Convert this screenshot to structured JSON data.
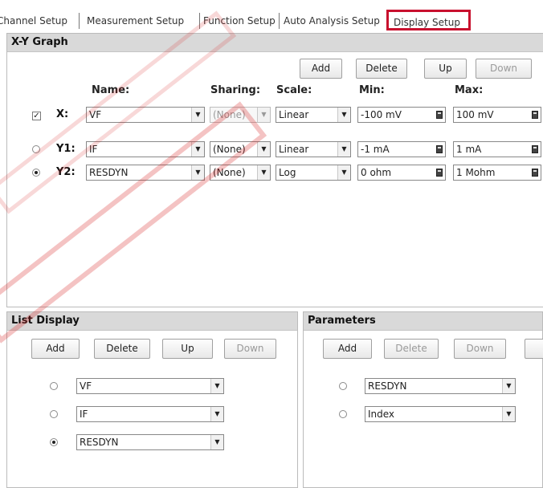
{
  "tabs": [
    {
      "label": "Channel Setup"
    },
    {
      "label": "Measurement Setup"
    },
    {
      "label": "Function Setup"
    },
    {
      "label": "Auto Analysis Setup"
    },
    {
      "label": "Display Setup"
    }
  ],
  "xy": {
    "title": "X-Y Graph",
    "buttons": {
      "add": "Add",
      "delete": "Delete",
      "up": "Up",
      "down": "Down"
    },
    "headers": {
      "name": "Name:",
      "sharing": "Sharing:",
      "scale": "Scale:",
      "min": "Min:",
      "max": "Max:"
    },
    "rows": [
      {
        "label": "X:",
        "name": "VF",
        "sharing": "(None)",
        "scale": "Linear",
        "min": "-100 mV",
        "max": "100 mV",
        "checked": true
      },
      {
        "label": "Y1:",
        "name": "IF",
        "sharing": "(None)",
        "scale": "Linear",
        "min": "-1 mA",
        "max": "1 mA",
        "selected": false
      },
      {
        "label": "Y2:",
        "name": "RESDYN",
        "sharing": "(None)",
        "scale": "Log",
        "min": "0 ohm",
        "max": "1 Mohm",
        "selected": true
      }
    ]
  },
  "list": {
    "title": "List Display",
    "buttons": {
      "add": "Add",
      "delete": "Delete",
      "up": "Up",
      "down": "Down"
    },
    "items": [
      {
        "name": "VF",
        "selected": false
      },
      {
        "name": "IF",
        "selected": false
      },
      {
        "name": "RESDYN",
        "selected": true
      }
    ]
  },
  "params": {
    "title": "Parameters",
    "buttons": {
      "add": "Add",
      "delete": "Delete",
      "down": "Down"
    },
    "items": [
      {
        "name": "RESDYN",
        "selected": false
      },
      {
        "name": "Index",
        "selected": false
      }
    ]
  }
}
